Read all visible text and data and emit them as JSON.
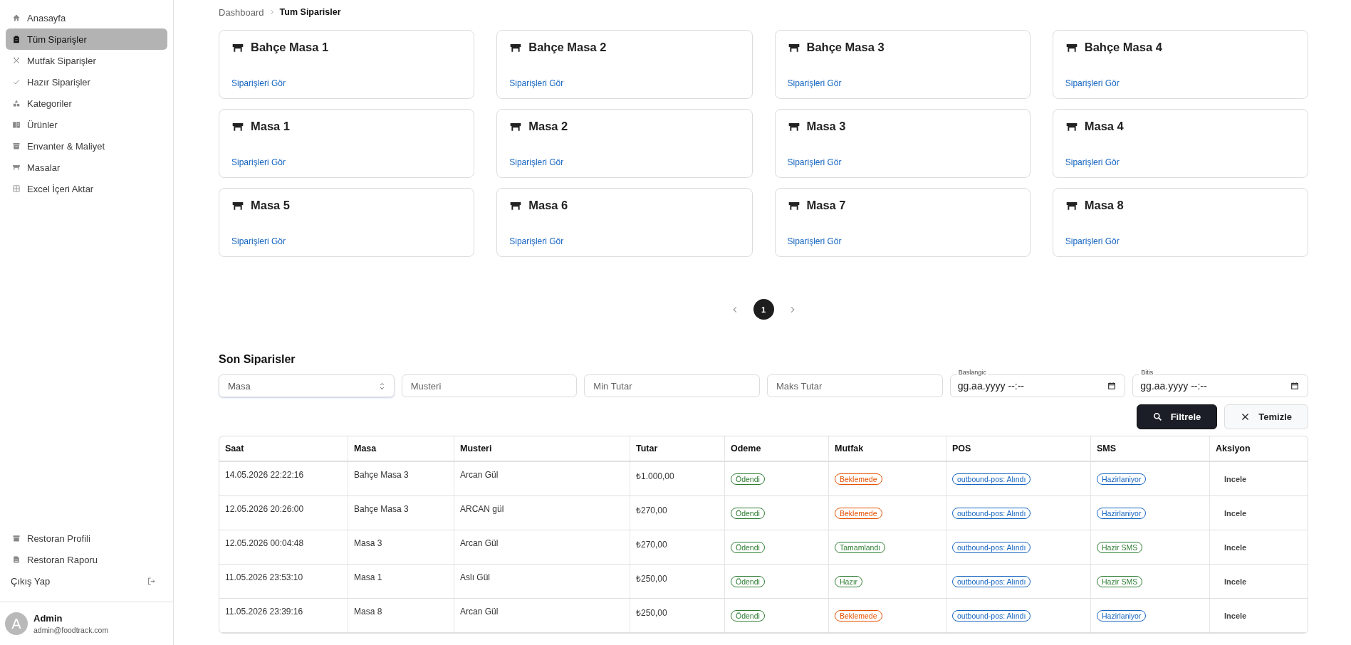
{
  "sidebar": {
    "items": [
      {
        "label": "Anasayfa",
        "selected": false
      },
      {
        "label": "Tüm Siparişler",
        "selected": true
      },
      {
        "label": "Mutfak Siparişler",
        "selected": false
      },
      {
        "label": "Hazır Siparişler",
        "selected": false
      },
      {
        "label": "Kategoriler",
        "selected": false
      },
      {
        "label": "Ürünler",
        "selected": false
      },
      {
        "label": "Envanter & Maliyet",
        "selected": false
      },
      {
        "label": "Masalar",
        "selected": false
      },
      {
        "label": "Excel İçeri Aktar",
        "selected": false
      }
    ],
    "bottom_items": [
      {
        "label": "Restoran Profili"
      },
      {
        "label": "Restoran Raporu"
      }
    ],
    "logout": {
      "label": "Çıkış Yap"
    },
    "user": {
      "initial": "A",
      "name": "Admin",
      "email": "admin@foodtrack.com"
    }
  },
  "breadcrumb": [
    "Dashboard",
    "Tum Siparisler"
  ],
  "tables": [
    {
      "name": "Bahçe Masa 1",
      "link": "Siparişleri Gör"
    },
    {
      "name": "Bahçe Masa 2",
      "link": "Siparişleri Gör"
    },
    {
      "name": "Bahçe Masa 3",
      "link": "Siparişleri Gör"
    },
    {
      "name": "Bahçe Masa 4",
      "link": "Siparişleri Gör"
    },
    {
      "name": "Masa 1",
      "link": "Siparişleri Gör"
    },
    {
      "name": "Masa 2",
      "link": "Siparişleri Gör"
    },
    {
      "name": "Masa 3",
      "link": "Siparişleri Gör"
    },
    {
      "name": "Masa 4",
      "link": "Siparişleri Gör"
    },
    {
      "name": "Masa 5",
      "link": "Siparişleri Gör"
    },
    {
      "name": "Masa 6",
      "link": "Siparişleri Gör"
    },
    {
      "name": "Masa 7",
      "link": "Siparişleri Gör"
    },
    {
      "name": "Masa 8",
      "link": "Siparişleri Gör"
    }
  ],
  "pagination": {
    "pages": [
      {
        "label": "1",
        "selected": true
      }
    ]
  },
  "recent_orders": {
    "title": "Son Siparisler",
    "filters": [
      {
        "kind": "select",
        "placeholder": "Masa"
      },
      {
        "kind": "text",
        "placeholder": "Musteri"
      },
      {
        "kind": "text",
        "placeholder": "Min Tutar"
      },
      {
        "kind": "text",
        "placeholder": "Maks Tutar"
      },
      {
        "kind": "datetime",
        "label": "Baslangic",
        "value": "gg.aa.yyyy --:--"
      },
      {
        "kind": "datetime",
        "label": "Bitis",
        "value": "gg.aa.yyyy --:--"
      }
    ],
    "buttons": [
      {
        "label": "Filtrele",
        "kind": "primary"
      },
      {
        "label": "Temizle",
        "kind": "secondary"
      }
    ],
    "columns": [
      "Saat",
      "Masa",
      "Musteri",
      "Tutar",
      "Odeme",
      "Mutfak",
      "POS",
      "SMS",
      "Aksiyon"
    ],
    "rows": [
      {
        "time": "14.05.2026 22:22:16",
        "table": "Bahçe Masa 3",
        "customer": "Arcan Gül",
        "amount": "₺1.000,00",
        "payment": {
          "text": "Ödendi",
          "color": "#2e7d32"
        },
        "kitchen": {
          "text": "Beklemede",
          "color": "#e65100"
        },
        "pos": {
          "text": "outbound-pos: Alındı",
          "color": "#1565c0"
        },
        "sms": {
          "text": "Hazirlaniyor",
          "color": "#1565c0"
        },
        "action": "Incele"
      },
      {
        "time": "12.05.2026 20:26:00",
        "table": "Bahçe Masa 3",
        "customer": "ARCAN gül",
        "amount": "₺270,00",
        "payment": {
          "text": "Ödendi",
          "color": "#2e7d32"
        },
        "kitchen": {
          "text": "Beklemede",
          "color": "#e65100"
        },
        "pos": {
          "text": "outbound-pos: Alındı",
          "color": "#1565c0"
        },
        "sms": {
          "text": "Hazirlaniyor",
          "color": "#1565c0"
        },
        "action": "Incele"
      },
      {
        "time": "12.05.2026 00:04:48",
        "table": "Masa 3",
        "customer": "Arcan Gül",
        "amount": "₺270,00",
        "payment": {
          "text": "Ödendi",
          "color": "#2e7d32"
        },
        "kitchen": {
          "text": "Tamamlandı",
          "color": "#2e7d32"
        },
        "pos": {
          "text": "outbound-pos: Alındı",
          "color": "#1565c0"
        },
        "sms": {
          "text": "Hazir SMS",
          "color": "#2e7d32"
        },
        "action": "Incele"
      },
      {
        "time": "11.05.2026 23:53:10",
        "table": "Masa 1",
        "customer": "Aslı Gül",
        "amount": "₺250,00",
        "payment": {
          "text": "Ödendi",
          "color": "#2e7d32"
        },
        "kitchen": {
          "text": "Hazır",
          "color": "#2e7d32"
        },
        "pos": {
          "text": "outbound-pos: Alındı",
          "color": "#1565c0"
        },
        "sms": {
          "text": "Hazir SMS",
          "color": "#2e7d32"
        },
        "action": "Incele"
      },
      {
        "time": "11.05.2026 23:39:16",
        "table": "Masa 8",
        "customer": "Arcan Gül",
        "amount": "₺250,00",
        "payment": {
          "text": "Ödendi",
          "color": "#2e7d32"
        },
        "kitchen": {
          "text": "Beklemede",
          "color": "#e65100"
        },
        "pos": {
          "text": "outbound-pos: Alındı",
          "color": "#1565c0"
        },
        "sms": {
          "text": "Hazirlaniyor",
          "color": "#1565c0"
        },
        "action": "Incele"
      }
    ]
  }
}
